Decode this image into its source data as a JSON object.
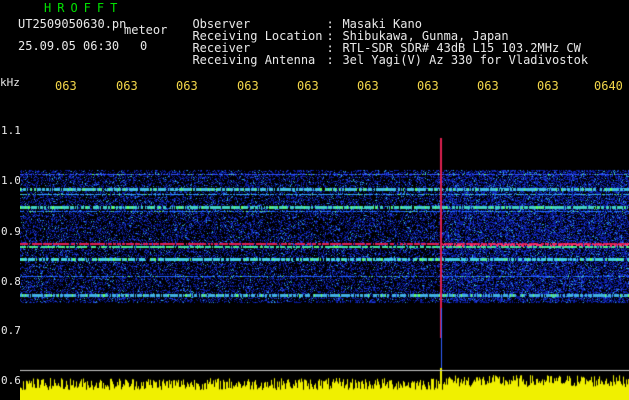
{
  "header": {
    "app_title": "HROFFT",
    "file_name": "UT2509050630.pn",
    "meteor_word": "meteor",
    "timestamp": "25.09.05 06:30",
    "count": "0",
    "fields": [
      {
        "label": "Observer",
        "sep": ":",
        "value": "Masaki Kano"
      },
      {
        "label": "Receiving Location",
        "sep": ":",
        "value": "Shibukawa, Gunma, Japan"
      },
      {
        "label": "Receiver",
        "sep": ":",
        "value": "RTL-SDR SDR# 43dB L15 103.2MHz CW"
      },
      {
        "label": "Receiving Antenna",
        "sep": ":",
        "value": "3el Yagi(V) Az 330 for Vladivostok"
      }
    ]
  },
  "axis": {
    "y_unit": "kHz",
    "y_ticks": [
      "1.1",
      "1.0",
      "0.9",
      "0.8",
      "0.7",
      "0.6"
    ],
    "x_ticks": [
      "063",
      "063",
      "063",
      "063",
      "063",
      "063",
      "063",
      "063",
      "063",
      "0640"
    ]
  },
  "colors": {
    "background": "#000000",
    "title": "#00e000",
    "text": "#e8e8e8",
    "x_tick": "#f2d64a",
    "noise": "#1030c0",
    "echo_line": "#e02050",
    "signal_bar": "#f0f000"
  }
}
